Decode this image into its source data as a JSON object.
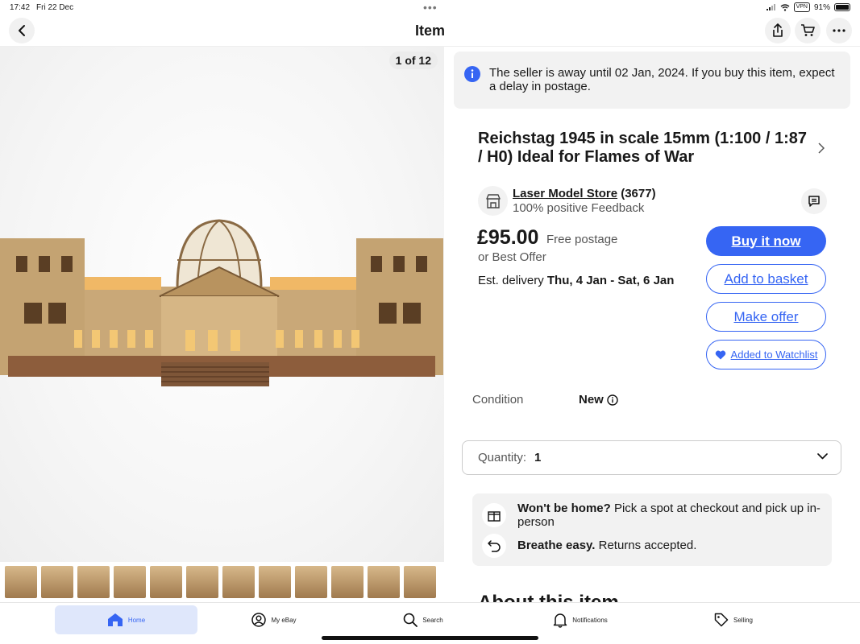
{
  "status_bar": {
    "time": "17:42",
    "date": "Fri 22 Dec",
    "vpn": "VPN",
    "battery": "91%"
  },
  "header": {
    "title": "Item"
  },
  "gallery": {
    "counter": "1 of 12",
    "thumbnail_count": 12
  },
  "notice": {
    "text": "The seller is away until 02 Jan, 2024. If you buy this item, expect a delay in postage."
  },
  "item": {
    "title": "Reichstag 1945 in scale 15mm (1:100 / 1:87 / H0) Ideal for  Flames of War"
  },
  "seller": {
    "name": "Laser Model Store",
    "count": "(3677)",
    "feedback": "100% positive Feedback"
  },
  "pricing": {
    "price": "£95.00",
    "postage": "Free postage",
    "best_offer": "or Best Offer",
    "delivery_label": "Est. delivery",
    "delivery_dates": "Thu, 4 Jan - Sat, 6 Jan"
  },
  "actions": {
    "buy_now": "Buy it now",
    "add_basket": "Add to basket",
    "make_offer": "Make offer",
    "watchlist": "Added to Watchlist"
  },
  "condition": {
    "label": "Condition",
    "value": "New"
  },
  "quantity": {
    "label": "Quantity:",
    "value": "1"
  },
  "perks": [
    {
      "bold": "Won't be home?",
      "text": " Pick a spot at checkout and pick up in-person"
    },
    {
      "bold": "Breathe easy.",
      "text": " Returns accepted."
    }
  ],
  "about": {
    "heading": "About this item"
  },
  "tabbar": {
    "home": "Home",
    "my_ebay": "My eBay",
    "search": "Search",
    "notifications": "Notifications",
    "selling": "Selling"
  },
  "colors": {
    "accent": "#3665f3",
    "panel": "#f2f2f2"
  }
}
